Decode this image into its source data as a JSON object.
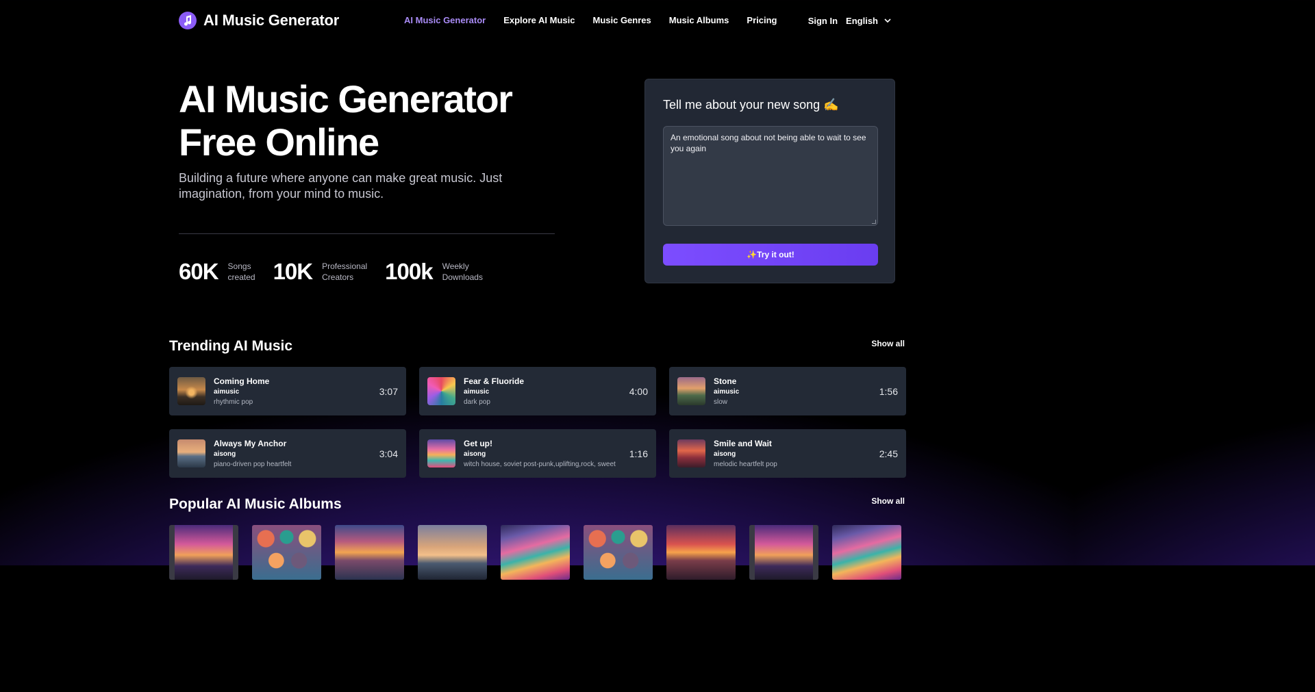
{
  "header": {
    "logo_text": "AI Music Generator",
    "nav": [
      {
        "label": "AI Music Generator",
        "active": true
      },
      {
        "label": "Explore AI Music",
        "active": false
      },
      {
        "label": "Music Genres",
        "active": false
      },
      {
        "label": "Music Albums",
        "active": false
      },
      {
        "label": "Pricing",
        "active": false
      }
    ],
    "sign_in": "Sign In",
    "language": "English"
  },
  "hero": {
    "title_line1": "AI Music Generator",
    "title_line2": "Free Online",
    "subtitle": "Building a future where anyone can make great music. Just imagination, from your mind to music.",
    "stats": [
      {
        "value": "60K",
        "label_line1": "Songs",
        "label_line2": "created"
      },
      {
        "value": "10K",
        "label_line1": "Professional",
        "label_line2": "Creators"
      },
      {
        "value": "100k",
        "label_line1": "Weekly",
        "label_line2": "Downloads"
      }
    ]
  },
  "form": {
    "title": "Tell me about your new song ✍️",
    "textarea_value": "An emotional song about not being able to wait to see you again",
    "button_label": "✨Try it out!"
  },
  "trending": {
    "title": "Trending AI Music",
    "show_all": "Show all",
    "tracks": [
      {
        "title": "Coming Home",
        "artist": "aimusic",
        "genre": "rhythmic pop",
        "duration": "3:07"
      },
      {
        "title": "Fear & Fluoride",
        "artist": "aimusic",
        "genre": "dark pop",
        "duration": "4:00"
      },
      {
        "title": "Stone",
        "artist": "aimusic",
        "genre": "slow",
        "duration": "1:56"
      },
      {
        "title": "Always My Anchor",
        "artist": "aisong",
        "genre": "piano-driven pop heartfelt",
        "duration": "3:04"
      },
      {
        "title": "Get up!",
        "artist": "aisong",
        "genre": "witch house, soviet post-punk,uplifting,rock, sweet",
        "duration": "1:16"
      },
      {
        "title": "Smile and Wait",
        "artist": "aisong",
        "genre": "melodic heartfelt pop",
        "duration": "2:45"
      }
    ]
  },
  "albums": {
    "title": "Popular AI Music Albums",
    "show_all": "Show all",
    "covers": [
      "window-sunset",
      "colorful-masks",
      "ocean-sunset",
      "lighthouse",
      "rainbow-hills",
      "colorful-masks",
      "mountain-sunset",
      "window-sunset",
      "rainbow-hills"
    ]
  },
  "colors": {
    "accent": "#8b5cf6",
    "nav_active": "#a98bf5",
    "card_bg": "#222834",
    "track_bg": "#232a36"
  }
}
